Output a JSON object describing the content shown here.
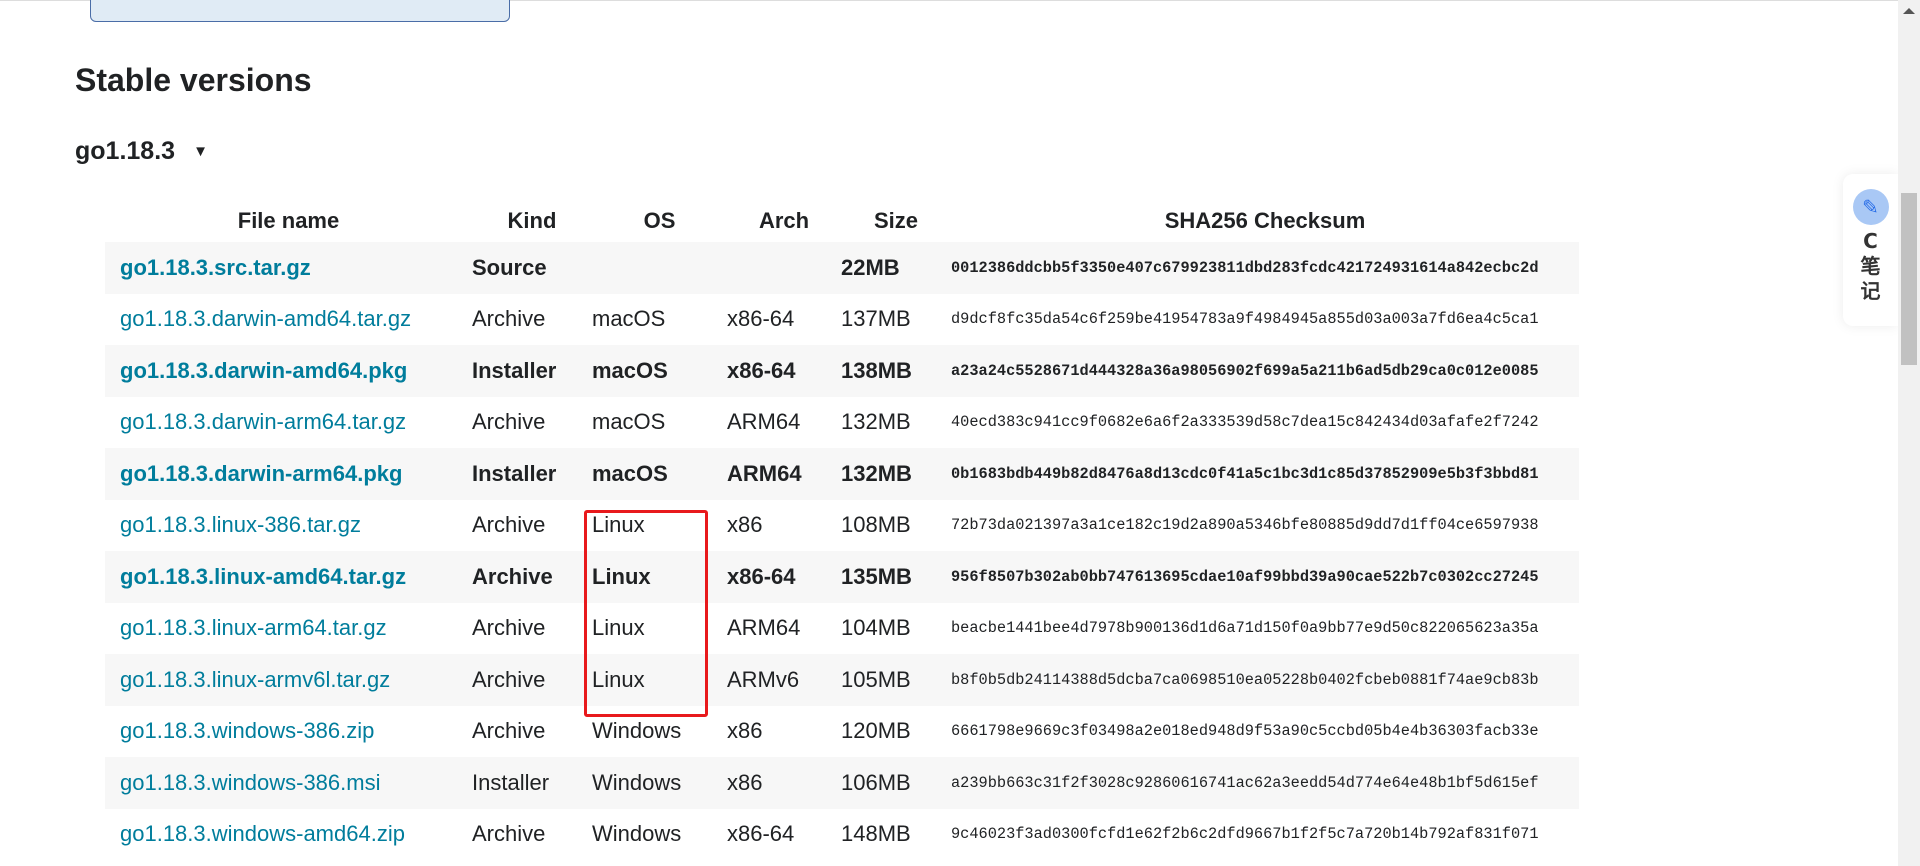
{
  "heading": "Stable versions",
  "version": {
    "label": "go1.18.3",
    "toggle": "▼"
  },
  "table": {
    "headers": [
      "File name",
      "Kind",
      "OS",
      "Arch",
      "Size",
      "SHA256 Checksum"
    ],
    "rows": [
      {
        "file": "go1.18.3.src.tar.gz",
        "kind": "Source",
        "os": "",
        "arch": "",
        "size": "22MB",
        "sum": "0012386ddcbb5f3350e407c679923811dbd283fcdc421724931614a842ecbc2d",
        "bold": true
      },
      {
        "file": "go1.18.3.darwin-amd64.tar.gz",
        "kind": "Archive",
        "os": "macOS",
        "arch": "x86-64",
        "size": "137MB",
        "sum": "d9dcf8fc35da54c6f259be41954783a9f4984945a855d03a003a7fd6ea4c5ca1",
        "bold": false
      },
      {
        "file": "go1.18.3.darwin-amd64.pkg",
        "kind": "Installer",
        "os": "macOS",
        "arch": "x86-64",
        "size": "138MB",
        "sum": "a23a24c5528671d444328a36a98056902f699a5a211b6ad5db29ca0c012e0085",
        "bold": true
      },
      {
        "file": "go1.18.3.darwin-arm64.tar.gz",
        "kind": "Archive",
        "os": "macOS",
        "arch": "ARM64",
        "size": "132MB",
        "sum": "40ecd383c941cc9f0682e6a6f2a333539d58c7dea15c842434d03afafe2f7242",
        "bold": false
      },
      {
        "file": "go1.18.3.darwin-arm64.pkg",
        "kind": "Installer",
        "os": "macOS",
        "arch": "ARM64",
        "size": "132MB",
        "sum": "0b1683bdb449b82d8476a8d13cdc0f41a5c1bc3d1c85d37852909e5b3f3bbd81",
        "bold": true
      },
      {
        "file": "go1.18.3.linux-386.tar.gz",
        "kind": "Archive",
        "os": "Linux",
        "arch": "x86",
        "size": "108MB",
        "sum": "72b73da021397a3a1ce182c19d2a890a5346bfe80885d9dd7d1ff04ce6597938",
        "bold": false
      },
      {
        "file": "go1.18.3.linux-amd64.tar.gz",
        "kind": "Archive",
        "os": "Linux",
        "arch": "x86-64",
        "size": "135MB",
        "sum": "956f8507b302ab0bb747613695cdae10af99bbd39a90cae522b7c0302cc27245",
        "bold": true
      },
      {
        "file": "go1.18.3.linux-arm64.tar.gz",
        "kind": "Archive",
        "os": "Linux",
        "arch": "ARM64",
        "size": "104MB",
        "sum": "beacbe1441bee4d7978b900136d1d6a71d150f0a9bb77e9d50c822065623a35a",
        "bold": false
      },
      {
        "file": "go1.18.3.linux-armv6l.tar.gz",
        "kind": "Archive",
        "os": "Linux",
        "arch": "ARMv6",
        "size": "105MB",
        "sum": "b8f0b5db24114388d5dcba7ca0698510ea05228b0402fcbeb0881f74ae9cb83b",
        "bold": false
      },
      {
        "file": "go1.18.3.windows-386.zip",
        "kind": "Archive",
        "os": "Windows",
        "arch": "x86",
        "size": "120MB",
        "sum": "6661798e9669c3f03498a2e018ed948d9f53a90c5ccbd05b4e4b36303facb33e",
        "bold": false
      },
      {
        "file": "go1.18.3.windows-386.msi",
        "kind": "Installer",
        "os": "Windows",
        "arch": "x86",
        "size": "106MB",
        "sum": "a239bb663c31f2f3028c92860616741ac62a3eedd54d774e64e48b1bf5d615ef",
        "bold": false
      },
      {
        "file": "go1.18.3.windows-amd64.zip",
        "kind": "Archive",
        "os": "Windows",
        "arch": "x86-64",
        "size": "148MB",
        "sum": "9c46023f3ad0300fcfd1e62f2b6c2dfd9667b1f2f5c7a720b14b792af831f071",
        "bold": false
      }
    ]
  },
  "widget": {
    "line1": "C",
    "line2": "笔",
    "line3": "记",
    "icon": "quill-note-icon"
  },
  "colors": {
    "link": "#007d9c",
    "highlight": "#e8191c",
    "stripe": "#f7f7f7"
  }
}
